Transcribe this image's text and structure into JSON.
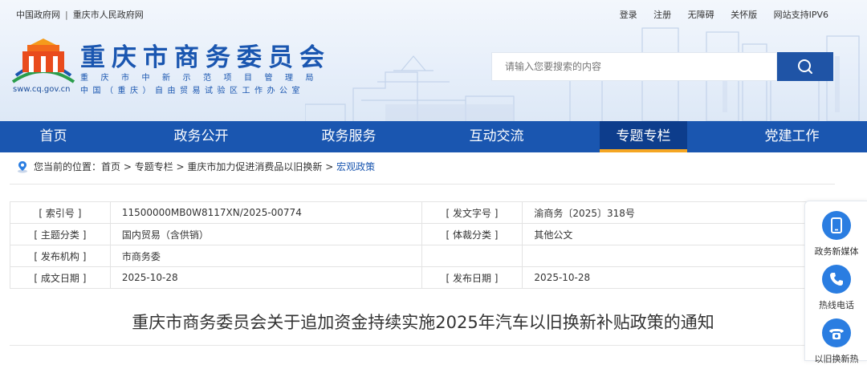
{
  "top": {
    "left_links": [
      "中国政府网",
      "重庆市人民政府网"
    ],
    "separator": "|",
    "right_links": [
      "登录",
      "注册",
      "无障碍",
      "关怀版",
      "网站支持IPV6"
    ]
  },
  "header": {
    "title": "重庆市商务委员会",
    "subtitle1": "重庆市中新示范项目管理局",
    "subtitle2": "中国（重庆）自由贸易试验区工作办公室",
    "domain": "sww.cq.gov.cn"
  },
  "search": {
    "placeholder": "请输入您要搜索的内容",
    "icon": "search-icon"
  },
  "nav": {
    "items": [
      "首页",
      "政务公开",
      "政务服务",
      "互动交流",
      "专题专栏",
      "党建工作"
    ],
    "active": "专题专栏",
    "accent": "#f5a623"
  },
  "breadcrumb": {
    "prefix": "您当前的位置：",
    "items": [
      "首页",
      "专题专栏",
      "重庆市加力促进消费品以旧换新",
      "宏观政策"
    ],
    "separator": " > "
  },
  "info": {
    "rows": [
      {
        "l1": "[ 索引号 ]",
        "v1": "11500000MB0W8117XN/2025-00774",
        "l2": "[ 发文字号 ]",
        "v2": "渝商务〔2025〕318号"
      },
      {
        "l1": "[ 主题分类 ]",
        "v1": "国内贸易（含供销）",
        "l2": "[ 体裁分类 ]",
        "v2": "其他公文"
      },
      {
        "l1": "[ 发布机构 ]",
        "v1": "市商务委",
        "l2": "",
        "v2": ""
      },
      {
        "l1": "[ 成文日期 ]",
        "v1": "2025-10-28",
        "l2": "[ 发布日期 ]",
        "v2": "2025-10-28"
      }
    ]
  },
  "document": {
    "title": "重庆市商务委员会关于追加资金持续实施2025年汽车以旧换新补贴政策的通知"
  },
  "side": {
    "items": [
      {
        "label": "政务新媒体",
        "icon": "phone-device-icon"
      },
      {
        "label": "热线电话",
        "icon": "telephone-icon"
      },
      {
        "label": "以旧换新热",
        "icon": "hotline-icon"
      }
    ]
  },
  "colors": {
    "primary": "#1a56b0",
    "nav_active": "#0d3d8c",
    "side_icon": "#2a7de1"
  }
}
